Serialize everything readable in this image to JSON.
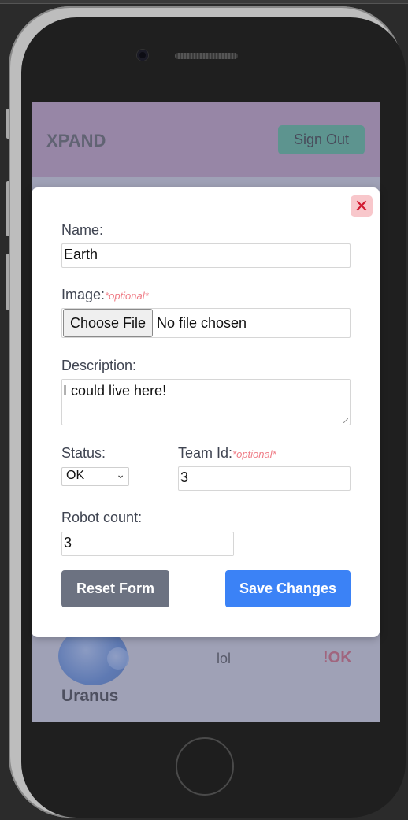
{
  "header": {
    "brand": "XPAND",
    "sign_out_label": "Sign Out"
  },
  "background_card": {
    "name": "Uranus",
    "description": "lol",
    "status": "!OK"
  },
  "modal": {
    "close_icon": "✕",
    "name_label": "Name:",
    "name_value": "Earth",
    "image_label": "Image:",
    "image_optional": "*optional*",
    "choose_file_label": "Choose File",
    "no_file_text": "No file chosen",
    "description_label": "Description:",
    "description_value": "I could live here!",
    "status_label": "Status:",
    "status_value": "OK",
    "team_id_label": "Team Id:",
    "team_id_optional": "*optional*",
    "team_id_value": "3",
    "robot_count_label": "Robot count:",
    "robot_count_value": "3",
    "reset_label": "Reset Form",
    "save_label": "Save Changes"
  },
  "colors": {
    "header_bg": "#c8a6c3",
    "sign_out_bg": "#5fc09a",
    "close_bg": "#f8c7cb",
    "close_fg": "#d1182f",
    "optional_text": "#ef7c86",
    "reset_bg": "#6c7281",
    "save_bg": "#3b82f6"
  },
  "icons": [
    "close-icon",
    "chevron-down-icon",
    "planet-image"
  ]
}
